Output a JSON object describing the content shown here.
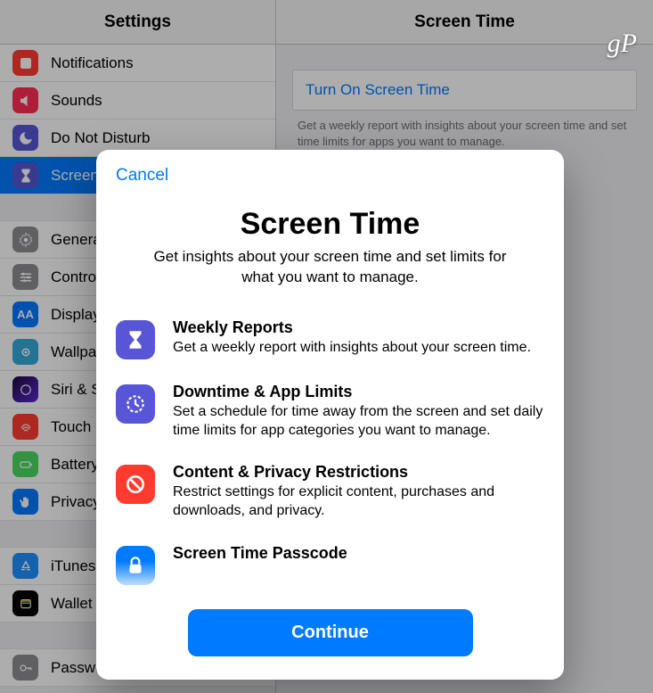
{
  "watermark": "gP",
  "sidebar": {
    "title": "Settings",
    "items": [
      {
        "label": "Notifications"
      },
      {
        "label": "Sounds"
      },
      {
        "label": "Do Not Disturb"
      },
      {
        "label": "Screen Time"
      },
      {
        "label": "General"
      },
      {
        "label": "Control Center"
      },
      {
        "label": "Display & Brightness"
      },
      {
        "label": "Wallpaper"
      },
      {
        "label": "Siri & Search"
      },
      {
        "label": "Touch ID & Passcode"
      },
      {
        "label": "Battery"
      },
      {
        "label": "Privacy"
      },
      {
        "label": "iTunes & App Store"
      },
      {
        "label": "Wallet & Apple Pay"
      },
      {
        "label": "Passwords & Accounts"
      }
    ]
  },
  "detail": {
    "title": "Screen Time",
    "turn_on_label": "Turn On Screen Time",
    "helper": "Get a weekly report with insights about your screen time and set time limits for apps you want to manage."
  },
  "modal": {
    "cancel": "Cancel",
    "title": "Screen Time",
    "subtitle": "Get insights about your screen time and set limits for what you want to manage.",
    "features": [
      {
        "title": "Weekly Reports",
        "desc": "Get a weekly report with insights about your screen time."
      },
      {
        "title": "Downtime & App Limits",
        "desc": "Set a schedule for time away from the screen and set daily time limits for app categories you want to manage."
      },
      {
        "title": "Content & Privacy Restrictions",
        "desc": "Restrict settings for explicit content, purchases and downloads, and privacy."
      },
      {
        "title": "Screen Time Passcode",
        "desc": ""
      }
    ],
    "continue": "Continue"
  }
}
